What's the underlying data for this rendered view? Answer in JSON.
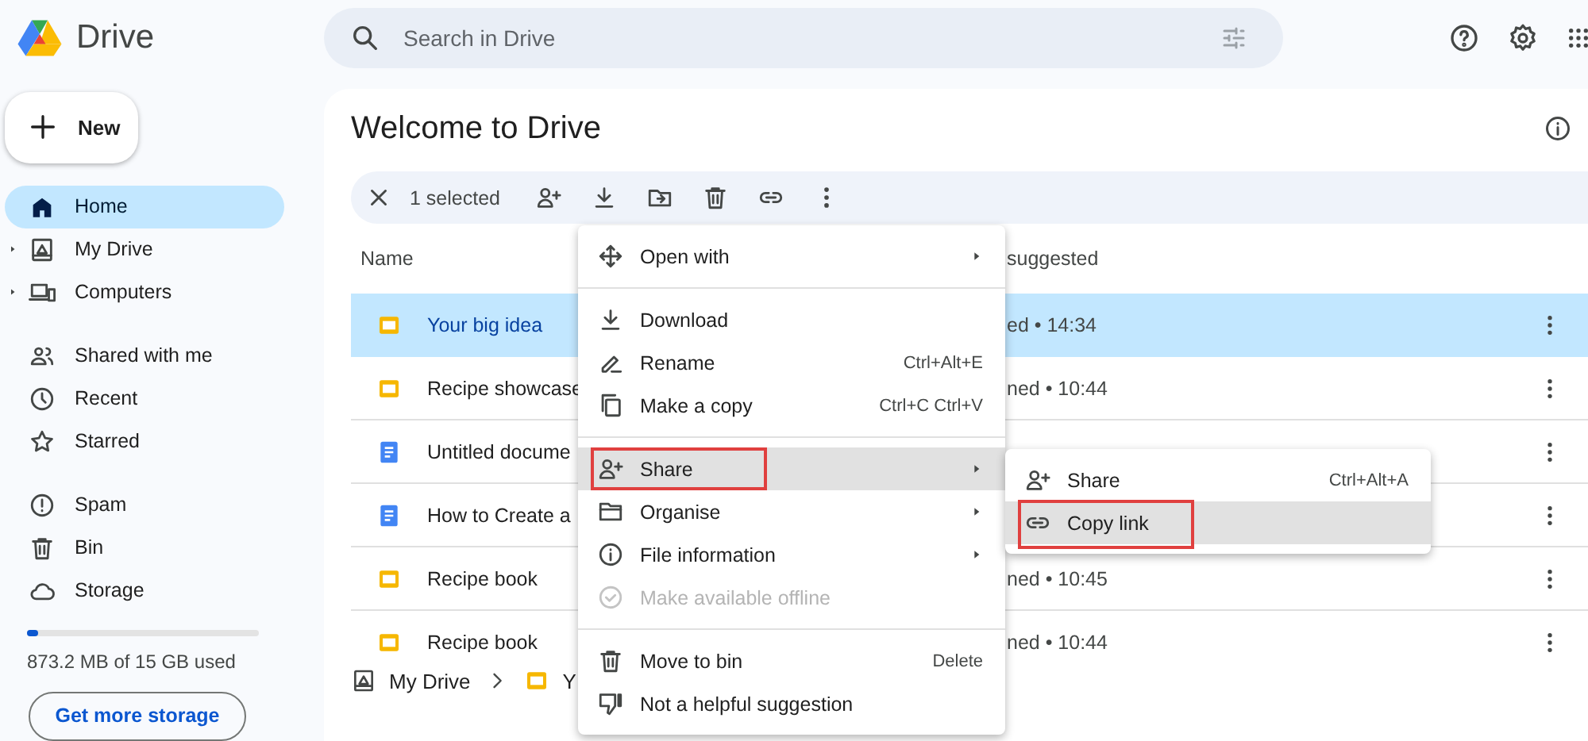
{
  "app": {
    "title": "Drive"
  },
  "search": {
    "placeholder": "Search in Drive"
  },
  "new_button": {
    "label": "New"
  },
  "sidebar": {
    "items": [
      {
        "label": "Home",
        "selected": true,
        "expander": false,
        "gap_before": false
      },
      {
        "label": "My Drive",
        "selected": false,
        "expander": true,
        "gap_before": false
      },
      {
        "label": "Computers",
        "selected": false,
        "expander": true,
        "gap_before": false
      },
      {
        "label": "Shared with me",
        "selected": false,
        "expander": false,
        "gap_before": true
      },
      {
        "label": "Recent",
        "selected": false,
        "expander": false,
        "gap_before": false
      },
      {
        "label": "Starred",
        "selected": false,
        "expander": false,
        "gap_before": false
      },
      {
        "label": "Spam",
        "selected": false,
        "expander": false,
        "gap_before": true
      },
      {
        "label": "Bin",
        "selected": false,
        "expander": false,
        "gap_before": false
      },
      {
        "label": "Storage",
        "selected": false,
        "expander": false,
        "gap_before": false
      }
    ]
  },
  "storage": {
    "level": 0.05,
    "usage": "873.2 MB of 15 GB used",
    "button": "Get more storage"
  },
  "main": {
    "title": "Welcome to Drive"
  },
  "selection_bar": {
    "count": "1 selected"
  },
  "files": {
    "columns": [
      "Name",
      "suggested"
    ],
    "rows": [
      {
        "name": "Your big idea",
        "kind": "slides",
        "reason": "ed • 14:34",
        "selected": true
      },
      {
        "name": "Recipe showcase",
        "kind": "slides",
        "reason": "ned • 10:44",
        "selected": false
      },
      {
        "name": "Untitled docume",
        "kind": "doc",
        "selected": false
      },
      {
        "name": "How to Create a",
        "kind": "doc",
        "selected": false
      },
      {
        "name": "Recipe book",
        "kind": "slides",
        "reason": "ned • 10:45",
        "selected": false
      },
      {
        "name": "Recipe book",
        "kind": "slides",
        "reason": "ned • 10:44",
        "selected": false
      }
    ]
  },
  "breadcrumb": {
    "items": [
      {
        "label": "My Drive",
        "kind": "drive"
      },
      {
        "label": "Y",
        "kind": "slides"
      }
    ]
  },
  "context_menu": {
    "groups": [
      {
        "items": [
          {
            "label": "Open with",
            "submenu": true,
            "disabled": false,
            "selected": false,
            "annotated": false
          }
        ]
      },
      {
        "items": [
          {
            "label": "Download",
            "submenu": false,
            "disabled": false,
            "selected": false,
            "annotated": false
          },
          {
            "label": "Rename",
            "shortcut": "Ctrl+Alt+E",
            "submenu": false,
            "disabled": false,
            "selected": false,
            "annotated": false
          },
          {
            "label": "Make a copy",
            "shortcut": "Ctrl+C Ctrl+V",
            "submenu": false,
            "disabled": false,
            "selected": false,
            "annotated": false
          }
        ]
      },
      {
        "items": [
          {
            "label": "Share",
            "submenu": true,
            "disabled": false,
            "selected": true,
            "annotated": true
          },
          {
            "label": "Organise",
            "submenu": true,
            "disabled": false,
            "selected": false,
            "annotated": false
          },
          {
            "label": "File information",
            "submenu": true,
            "disabled": false,
            "selected": false,
            "annotated": false
          },
          {
            "label": "Make available offline",
            "submenu": false,
            "disabled": true,
            "selected": false,
            "annotated": false
          }
        ]
      },
      {
        "items": [
          {
            "label": "Move to bin",
            "shortcut": "Delete",
            "submenu": false,
            "disabled": false,
            "selected": false,
            "annotated": false
          },
          {
            "label": "Not a helpful suggestion",
            "submenu": false,
            "disabled": false,
            "selected": false,
            "annotated": false
          }
        ]
      }
    ]
  },
  "submenu": {
    "items": [
      {
        "label": "Share",
        "shortcut": "Ctrl+Alt+A",
        "selected": false,
        "annotated": false
      },
      {
        "label": "Copy link",
        "selected": true,
        "annotated": true
      }
    ]
  }
}
